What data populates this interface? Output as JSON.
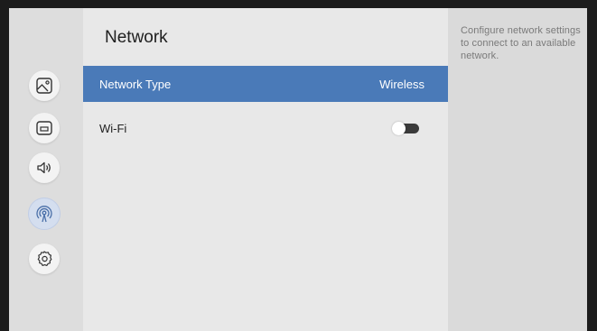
{
  "page": {
    "title": "Network"
  },
  "sidebar": {
    "items": [
      {
        "icon": "picture-icon",
        "active": false
      },
      {
        "icon": "screen-icon",
        "active": false
      },
      {
        "icon": "sound-icon",
        "active": false
      },
      {
        "icon": "network-icon",
        "active": true
      },
      {
        "icon": "settings-gear-icon",
        "active": false
      }
    ]
  },
  "menu": {
    "network_type": {
      "label": "Network Type",
      "value": "Wireless"
    },
    "wifi": {
      "label": "Wi-Fi",
      "enabled": false
    }
  },
  "help": {
    "text": "Configure network settings to connect to an available network."
  },
  "colors": {
    "accent": "#4a7ab8",
    "frame": "#1c1c1c",
    "active_rail_bg": "#d4deef"
  }
}
